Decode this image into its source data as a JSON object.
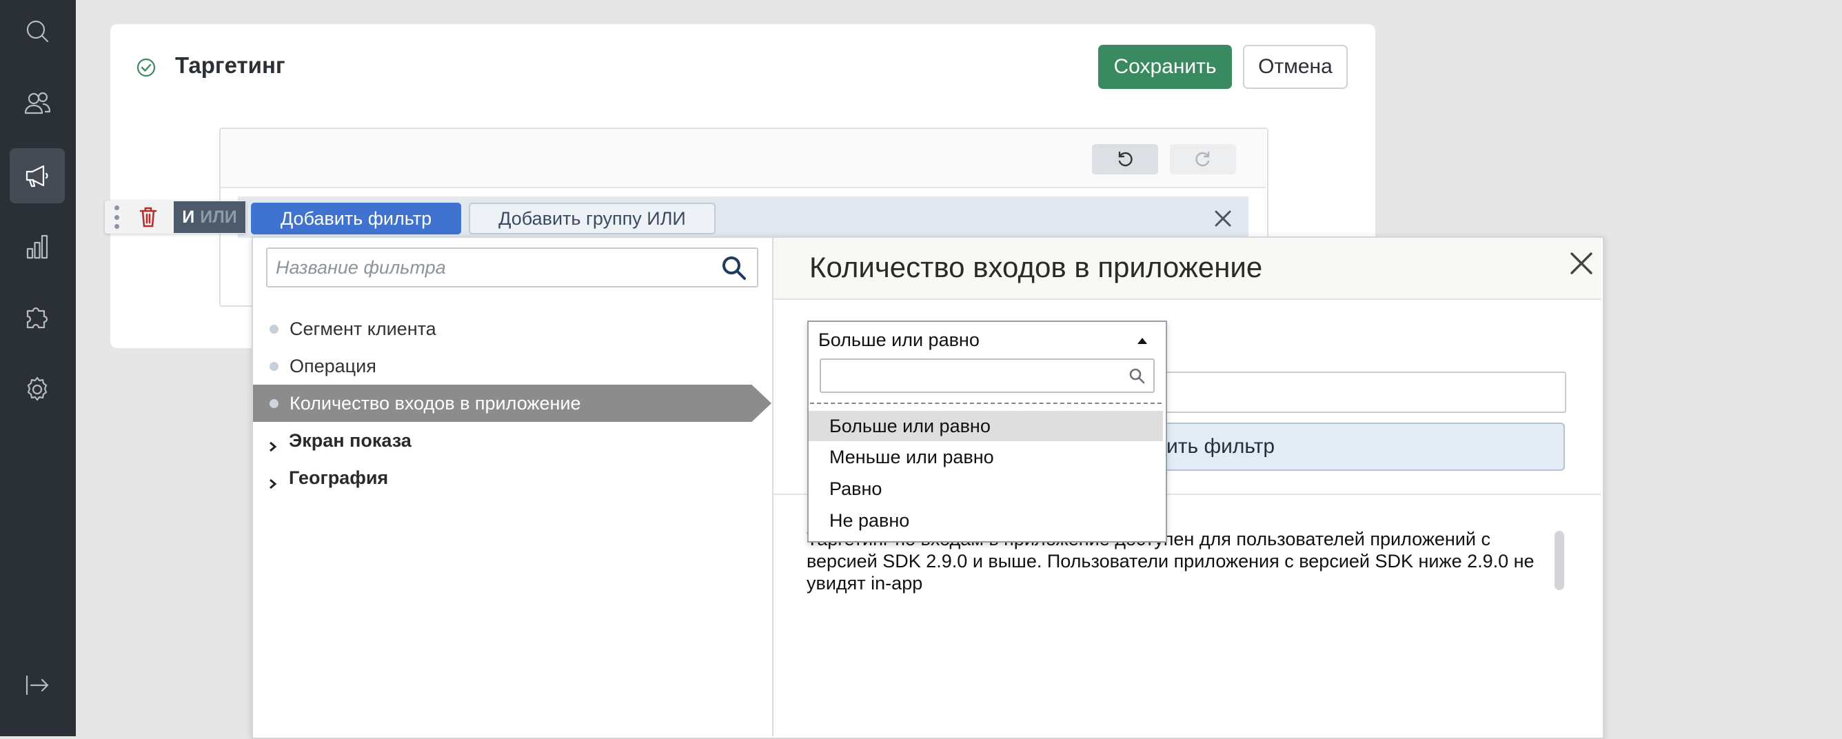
{
  "sidebar": {
    "items": [
      {
        "icon": "search-icon"
      },
      {
        "icon": "users-icon"
      },
      {
        "icon": "megaphone-icon",
        "active": true
      },
      {
        "icon": "bar-chart-icon"
      },
      {
        "icon": "puzzle-icon"
      },
      {
        "icon": "gear-icon"
      },
      {
        "icon": "logout-icon"
      }
    ]
  },
  "card": {
    "title": "Таргетинг",
    "save_label": "Сохранить",
    "cancel_label": "Отмена"
  },
  "filter_row": {
    "logic_and": "И",
    "logic_or": "ИЛИ",
    "add_filter_label": "Добавить фильтр",
    "add_group_label": "Добавить группу ИЛИ"
  },
  "popup": {
    "search_placeholder": "Название фильтра",
    "items": [
      {
        "label": "Сегмент клиента"
      },
      {
        "label": "Операция"
      },
      {
        "label": "Количество входов в приложение",
        "selected": true
      }
    ],
    "groups": [
      {
        "label": "Экран показа"
      },
      {
        "label": "География"
      }
    ],
    "title": "Количество входов в приложение",
    "apply_label": "ить фильтр",
    "note": "Таргетинг по входам в приложение доступен для пользователей приложений с версией SDK 2.9.0 и выше. Пользователи приложения с версией SDK ниже 2.9.0 не увидят in-app"
  },
  "dropdown": {
    "selected": "Больше или равно",
    "options": [
      "Больше или равно",
      "Меньше или равно",
      "Равно",
      "Не равно"
    ]
  },
  "colors": {
    "sidebar_bg": "#2b2f36",
    "save_bg": "#3a8a61",
    "add_filter_bg": "#3f73cf",
    "trash": "#b52f2f"
  }
}
